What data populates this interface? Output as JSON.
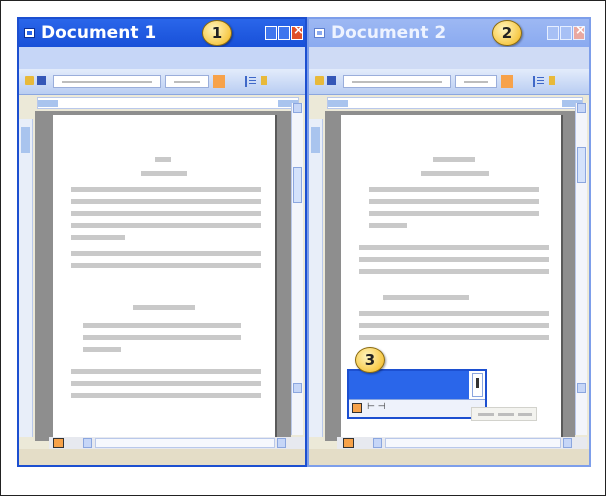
{
  "window1": {
    "title": "Document 1",
    "callout": "1"
  },
  "window2": {
    "title": "Document 2",
    "callout": "2"
  },
  "popup": {
    "callout": "3",
    "status_text": "⊢ ⊣"
  },
  "icons": [
    "app-icon",
    "minimize-icon",
    "maximize-icon",
    "close-icon",
    "open-folder-icon",
    "save-icon",
    "bullet-list-icon",
    "view-mode-icon"
  ],
  "colors": {
    "active_title": "#2a66ea",
    "inactive_title": "#9db8f3",
    "callout": "#f7c948",
    "close": "#e0502a"
  }
}
